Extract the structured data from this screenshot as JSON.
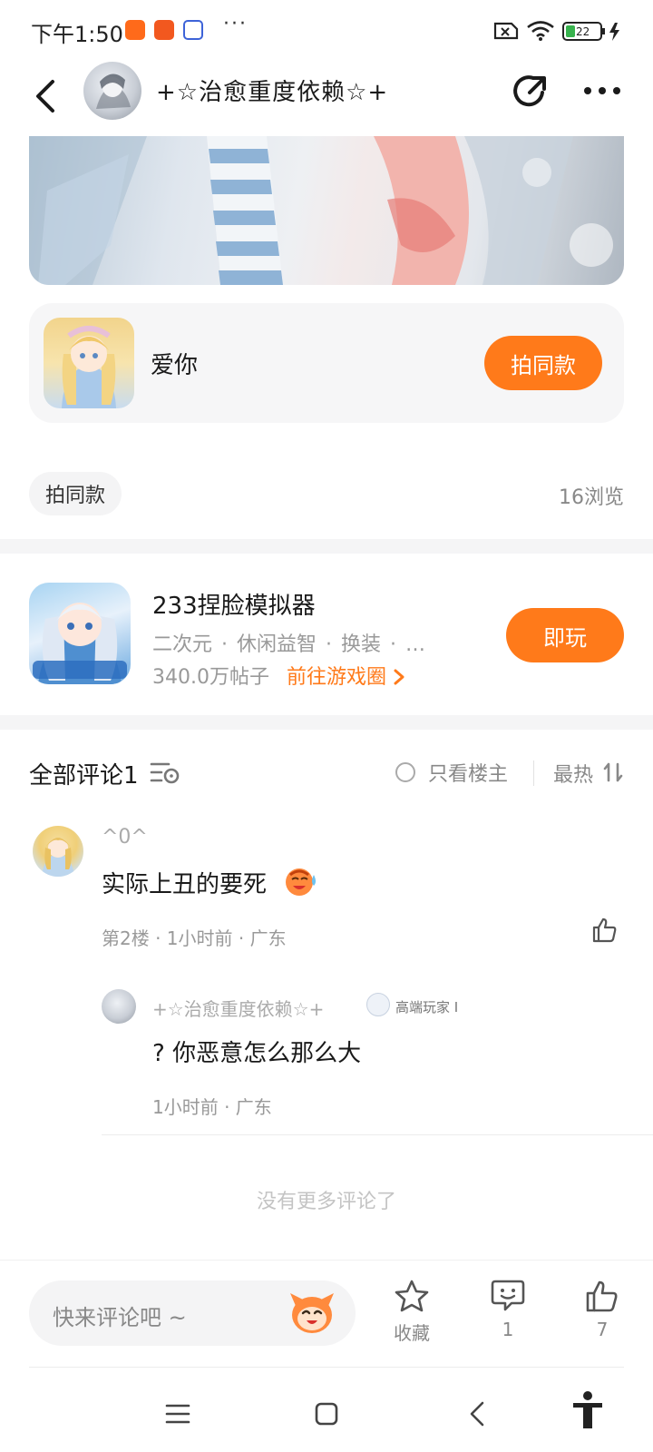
{
  "status_bar": {
    "time": "下午1:50",
    "app_icons": [
      "wallet-app-icon",
      "233-app-icon",
      "baidu-app-icon"
    ],
    "more": "···",
    "battery": "22"
  },
  "header": {
    "title": "+☆治愈重度依赖☆+",
    "back_icon": "chevron-left-icon",
    "share_icon": "share-icon",
    "more_icon": "more-dots-icon"
  },
  "same_style_card": {
    "name": "爱你",
    "button": "拍同款"
  },
  "post_meta": {
    "tag": "拍同款",
    "views": "16浏览"
  },
  "game_card": {
    "name": "233捏脸模拟器",
    "tags": [
      "二次元",
      "休闲益智",
      "换装",
      "…"
    ],
    "posts": "340.0万帖子",
    "link": "前往游戏圈",
    "play_button": "即玩"
  },
  "comments_header": {
    "title": "全部评论1",
    "only_owner": "只看楼主",
    "sort": "最热"
  },
  "comments": [
    {
      "user": "^0^",
      "text": "实际上丑的要死",
      "meta": "第2楼 · 1小时前 · 广东",
      "reply": {
        "user": "+☆治愈重度依赖☆+",
        "badge": "高端玩家 I",
        "text": "? 你恶意怎么那么大",
        "meta": "1小时前 · 广东"
      }
    }
  ],
  "no_more": "没有更多评论了",
  "bottom_bar": {
    "placeholder": "快来评论吧 ~",
    "collect_label": "收藏",
    "comment_count": "1",
    "like_count": "7"
  },
  "colors": {
    "accent": "#ff7a1a",
    "muted_text": "#888888",
    "separator": "#f5f5f6"
  }
}
